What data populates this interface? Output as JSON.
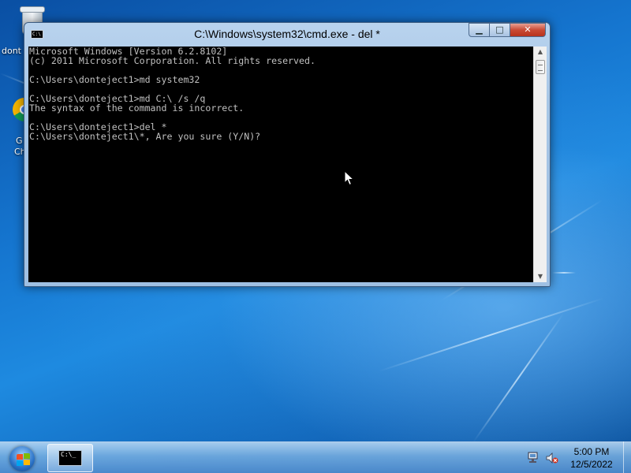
{
  "desktop": {
    "icons": [
      {
        "name": "recycle-bin",
        "label": "dont"
      },
      {
        "name": "google-chrome",
        "label_line1": "G",
        "label_line2": "Ch"
      }
    ]
  },
  "window": {
    "title": "C:\\Windows\\system32\\cmd.exe - del  *",
    "icon_text": "C:\\",
    "buttons": {
      "minimize": "▁",
      "maximize": "□",
      "close": "✕"
    },
    "console_lines": [
      "Microsoft Windows [Version 6.2.8102]",
      "(c) 2011 Microsoft Corporation. All rights reserved.",
      "",
      "C:\\Users\\donteject1>md system32",
      "",
      "C:\\Users\\donteject1>md C:\\ /s /q",
      "The syntax of the command is incorrect.",
      "",
      "C:\\Users\\donteject1>del *",
      "C:\\Users\\donteject1\\*, Are you sure (Y/N)?"
    ],
    "scrollbar": {
      "up_arrow": "▲",
      "down_arrow": "▼"
    }
  },
  "taskbar": {
    "start_label": "Start",
    "apps": [
      {
        "name": "cmd",
        "icon_text": "C:\\_"
      }
    ],
    "tray": {
      "network": "network-icon",
      "volume": "volume-muted-icon"
    },
    "clock": {
      "time": "5:00 PM",
      "date": "12/5/2022"
    }
  },
  "colors": {
    "console_background": "#000000",
    "console_text": "#c0c0c0",
    "close_button": "#c94a35",
    "taskbar": "#78afe1"
  }
}
